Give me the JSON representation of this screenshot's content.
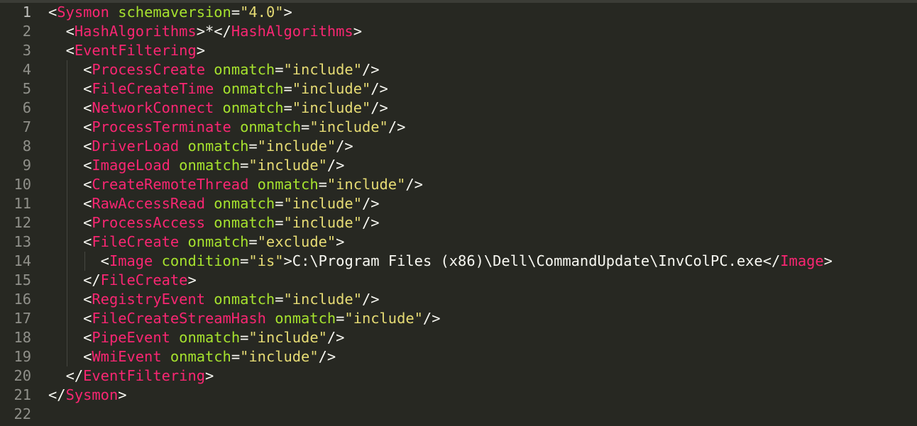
{
  "editor": {
    "colors": {
      "background": "#272822",
      "tag": "#f92672",
      "attribute": "#a6e22e",
      "string": "#e6db74",
      "text": "#f8f8f2",
      "line_number": "#90908a"
    },
    "current_line": 1,
    "lines": [
      {
        "n": "1",
        "indent": 0,
        "tokens": [
          [
            "p",
            "<"
          ],
          [
            "t",
            "Sysmon"
          ],
          [
            "p",
            " "
          ],
          [
            "a",
            "schemaversion"
          ],
          [
            "p",
            "="
          ],
          [
            "s",
            "\"4.0\""
          ],
          [
            "p",
            ">"
          ]
        ]
      },
      {
        "n": "2",
        "indent": 1,
        "tokens": [
          [
            "p",
            "<"
          ],
          [
            "t",
            "HashAlgorithms"
          ],
          [
            "p",
            ">*</"
          ],
          [
            "t",
            "HashAlgorithms"
          ],
          [
            "p",
            ">"
          ]
        ]
      },
      {
        "n": "3",
        "indent": 1,
        "tokens": [
          [
            "p",
            "<"
          ],
          [
            "t",
            "EventFiltering"
          ],
          [
            "p",
            ">"
          ]
        ]
      },
      {
        "n": "4",
        "indent": 2,
        "tokens": [
          [
            "p",
            "<"
          ],
          [
            "t",
            "ProcessCreate"
          ],
          [
            "p",
            " "
          ],
          [
            "a",
            "onmatch"
          ],
          [
            "p",
            "="
          ],
          [
            "s",
            "\"include\""
          ],
          [
            "p",
            "/>"
          ]
        ]
      },
      {
        "n": "5",
        "indent": 2,
        "tokens": [
          [
            "p",
            "<"
          ],
          [
            "t",
            "FileCreateTime"
          ],
          [
            "p",
            " "
          ],
          [
            "a",
            "onmatch"
          ],
          [
            "p",
            "="
          ],
          [
            "s",
            "\"include\""
          ],
          [
            "p",
            "/>"
          ]
        ]
      },
      {
        "n": "6",
        "indent": 2,
        "tokens": [
          [
            "p",
            "<"
          ],
          [
            "t",
            "NetworkConnect"
          ],
          [
            "p",
            " "
          ],
          [
            "a",
            "onmatch"
          ],
          [
            "p",
            "="
          ],
          [
            "s",
            "\"include\""
          ],
          [
            "p",
            "/>"
          ]
        ]
      },
      {
        "n": "7",
        "indent": 2,
        "tokens": [
          [
            "p",
            "<"
          ],
          [
            "t",
            "ProcessTerminate"
          ],
          [
            "p",
            " "
          ],
          [
            "a",
            "onmatch"
          ],
          [
            "p",
            "="
          ],
          [
            "s",
            "\"include\""
          ],
          [
            "p",
            "/>"
          ]
        ]
      },
      {
        "n": "8",
        "indent": 2,
        "tokens": [
          [
            "p",
            "<"
          ],
          [
            "t",
            "DriverLoad"
          ],
          [
            "p",
            " "
          ],
          [
            "a",
            "onmatch"
          ],
          [
            "p",
            "="
          ],
          [
            "s",
            "\"include\""
          ],
          [
            "p",
            "/>"
          ]
        ]
      },
      {
        "n": "9",
        "indent": 2,
        "tokens": [
          [
            "p",
            "<"
          ],
          [
            "t",
            "ImageLoad"
          ],
          [
            "p",
            " "
          ],
          [
            "a",
            "onmatch"
          ],
          [
            "p",
            "="
          ],
          [
            "s",
            "\"include\""
          ],
          [
            "p",
            "/>"
          ]
        ]
      },
      {
        "n": "10",
        "indent": 2,
        "tokens": [
          [
            "p",
            "<"
          ],
          [
            "t",
            "CreateRemoteThread"
          ],
          [
            "p",
            " "
          ],
          [
            "a",
            "onmatch"
          ],
          [
            "p",
            "="
          ],
          [
            "s",
            "\"include\""
          ],
          [
            "p",
            "/>"
          ]
        ]
      },
      {
        "n": "11",
        "indent": 2,
        "tokens": [
          [
            "p",
            "<"
          ],
          [
            "t",
            "RawAccessRead"
          ],
          [
            "p",
            " "
          ],
          [
            "a",
            "onmatch"
          ],
          [
            "p",
            "="
          ],
          [
            "s",
            "\"include\""
          ],
          [
            "p",
            "/>"
          ]
        ]
      },
      {
        "n": "12",
        "indent": 2,
        "tokens": [
          [
            "p",
            "<"
          ],
          [
            "t",
            "ProcessAccess"
          ],
          [
            "p",
            " "
          ],
          [
            "a",
            "onmatch"
          ],
          [
            "p",
            "="
          ],
          [
            "s",
            "\"include\""
          ],
          [
            "p",
            "/>"
          ]
        ]
      },
      {
        "n": "13",
        "indent": 2,
        "tokens": [
          [
            "p",
            "<"
          ],
          [
            "t",
            "FileCreate"
          ],
          [
            "p",
            " "
          ],
          [
            "a",
            "onmatch"
          ],
          [
            "p",
            "="
          ],
          [
            "s",
            "\"exclude\""
          ],
          [
            "p",
            ">"
          ]
        ]
      },
      {
        "n": "14",
        "indent": 3,
        "tokens": [
          [
            "p",
            "<"
          ],
          [
            "t",
            "Image"
          ],
          [
            "p",
            " "
          ],
          [
            "a",
            "condition"
          ],
          [
            "p",
            "="
          ],
          [
            "s",
            "\"is\""
          ],
          [
            "p",
            ">"
          ],
          [
            "x",
            "C:\\Program Files (x86)\\Dell\\CommandUpdate\\InvColPC.exe"
          ],
          [
            "p",
            "</"
          ],
          [
            "t",
            "Image"
          ],
          [
            "p",
            ">"
          ]
        ]
      },
      {
        "n": "15",
        "indent": 2,
        "tokens": [
          [
            "p",
            "</"
          ],
          [
            "t",
            "FileCreate"
          ],
          [
            "p",
            ">"
          ]
        ]
      },
      {
        "n": "16",
        "indent": 2,
        "tokens": [
          [
            "p",
            "<"
          ],
          [
            "t",
            "RegistryEvent"
          ],
          [
            "p",
            " "
          ],
          [
            "a",
            "onmatch"
          ],
          [
            "p",
            "="
          ],
          [
            "s",
            "\"include\""
          ],
          [
            "p",
            "/>"
          ]
        ]
      },
      {
        "n": "17",
        "indent": 2,
        "tokens": [
          [
            "p",
            "<"
          ],
          [
            "t",
            "FileCreateStreamHash"
          ],
          [
            "p",
            " "
          ],
          [
            "a",
            "onmatch"
          ],
          [
            "p",
            "="
          ],
          [
            "s",
            "\"include\""
          ],
          [
            "p",
            "/>"
          ]
        ]
      },
      {
        "n": "18",
        "indent": 2,
        "tokens": [
          [
            "p",
            "<"
          ],
          [
            "t",
            "PipeEvent"
          ],
          [
            "p",
            " "
          ],
          [
            "a",
            "onmatch"
          ],
          [
            "p",
            "="
          ],
          [
            "s",
            "\"include\""
          ],
          [
            "p",
            "/>"
          ]
        ]
      },
      {
        "n": "19",
        "indent": 2,
        "tokens": [
          [
            "p",
            "<"
          ],
          [
            "t",
            "WmiEvent"
          ],
          [
            "p",
            " "
          ],
          [
            "a",
            "onmatch"
          ],
          [
            "p",
            "="
          ],
          [
            "s",
            "\"include\""
          ],
          [
            "p",
            "/>"
          ]
        ]
      },
      {
        "n": "20",
        "indent": 1,
        "tokens": [
          [
            "p",
            "</"
          ],
          [
            "t",
            "EventFiltering"
          ],
          [
            "p",
            ">"
          ]
        ]
      },
      {
        "n": "21",
        "indent": 0,
        "tokens": [
          [
            "p",
            "</"
          ],
          [
            "t",
            "Sysmon"
          ],
          [
            "p",
            ">"
          ]
        ]
      },
      {
        "n": "22",
        "indent": 0,
        "tokens": []
      }
    ]
  }
}
